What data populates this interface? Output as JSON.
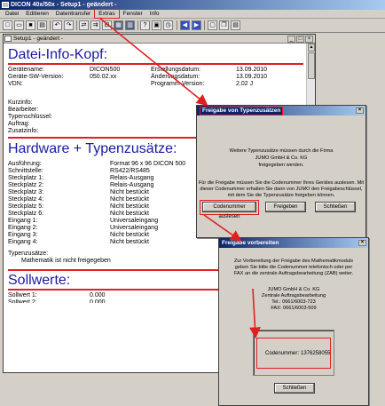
{
  "app": {
    "title": "DICON 40x/50x - Setup1 - geändert -",
    "menu": [
      "Datei",
      "Editieren",
      "Datentransfer",
      "Extras",
      "Fenster",
      "Info"
    ]
  },
  "document": {
    "title": "Setup1 - geändert -",
    "header_title": "Datei-Info-Kopf:",
    "info_left": [
      {
        "label": "Gerätename:",
        "value": "DICON500"
      },
      {
        "label": "Geräte-SW-Version:",
        "value": "050.02.xx"
      },
      {
        "label": "VDN:",
        "value": ""
      }
    ],
    "info_right": [
      {
        "label": "Erstellungsdatum:",
        "value": "13.09.2010"
      },
      {
        "label": "Änderungsdatum:",
        "value": "13.09.2010"
      },
      {
        "label": "Programm-Version:",
        "value": "2.02 J"
      }
    ],
    "info_fields": [
      "Kurzinfo:",
      "Bearbeiter:",
      "Typenschlüssel:",
      "Auftrag:",
      "Zusatzinfo:"
    ],
    "hardware_title": "Hardware + Typenzusätze:",
    "hardware_rows": [
      {
        "label": "Ausführung:",
        "value": "Format 96 x 96 DICON 500"
      },
      {
        "label": "Schnittstelle:",
        "value": "RS422/RS485"
      },
      {
        "label": "Steckplatz 1:",
        "value": "Relais-Ausgang"
      },
      {
        "label": "Steckplatz 2:",
        "value": "Relais-Ausgang"
      },
      {
        "label": "Steckplatz 3:",
        "value": "Nicht bestückt"
      },
      {
        "label": "Steckplatz 4:",
        "value": "Nicht bestückt"
      },
      {
        "label": "Steckplatz 5:",
        "value": "Nicht bestückt"
      },
      {
        "label": "Steckplatz 6:",
        "value": "Nicht bestückt"
      },
      {
        "label": "Eingang 1:",
        "value": "Universaleingang"
      },
      {
        "label": "Eingang 2:",
        "value": "Universaleingang"
      },
      {
        "label": "Eingang 3:",
        "value": "Nicht bestückt"
      },
      {
        "label": "Eingang 4:",
        "value": "Nicht bestückt"
      }
    ],
    "typenzusaetze_label": "Typenzusätze:",
    "typenzusaetze_value": "Mathematik ist nicht freigegeben",
    "sollwerte_title": "Sollwerte:",
    "sollwerte_rows": [
      {
        "label": "Sollwert 1:",
        "value": "0.000"
      },
      {
        "label": "Sollwert 2:",
        "value": "0.000"
      }
    ]
  },
  "dialog1": {
    "title": "Freigabe von Typenzusätzen",
    "line1": "Weitere Typenzusätze müssen durch die Firma",
    "line2": "JUMO GmbH & Co. KG",
    "line3": "freigegeben werden.",
    "para1": "Für die Freigabe müssen Sie die Codenummer Ihres Gerätes auslesen. Mit",
    "para2": "dieser Codenummer erhalten Sie dann von JUMO den Freigabeschlüssel,",
    "para3": "mit dem Sie die Typenzusätze freigeben können.",
    "btn_read": "Codenummer auslesen",
    "btn_release": "Freigeben",
    "btn_close": "Schließen"
  },
  "dialog2": {
    "title": "Freigabe vorbereiten",
    "para1": "Zur Vorbereitung der Freigabe des Mathematikmoduls",
    "para2": "geben Sie bitte die Codenummer telefonisch oder per",
    "para3": "FAX an die zentrale Auftragsbearbeitung (ZAB) weiter.",
    "company": "JUMO GmbH & Co. KG",
    "dept": "Zentrale Auftragsbearbeitung",
    "tel": "Tel.: 0661/6003-723",
    "fax": "FAX: 0661/6003-509",
    "code_label": "Codenummer:",
    "code_value": "1376258055",
    "btn_close": "Schließen"
  },
  "colors": {
    "annotation": "#e02020",
    "heading": "#1a1aa0",
    "titlebar": "#0a246a"
  },
  "toolbar_icons": [
    "new-file-icon",
    "open-folder-icon",
    "save-icon",
    "print-icon",
    "undo-icon",
    "redo-icon",
    "read-device-icon",
    "write-device-icon",
    "compare-icon",
    "settings-icon",
    "info-icon",
    "help-icon",
    "navigate-left-icon",
    "navigate-right-icon",
    "window-icon",
    "cascade-icon",
    "tile-icon"
  ]
}
